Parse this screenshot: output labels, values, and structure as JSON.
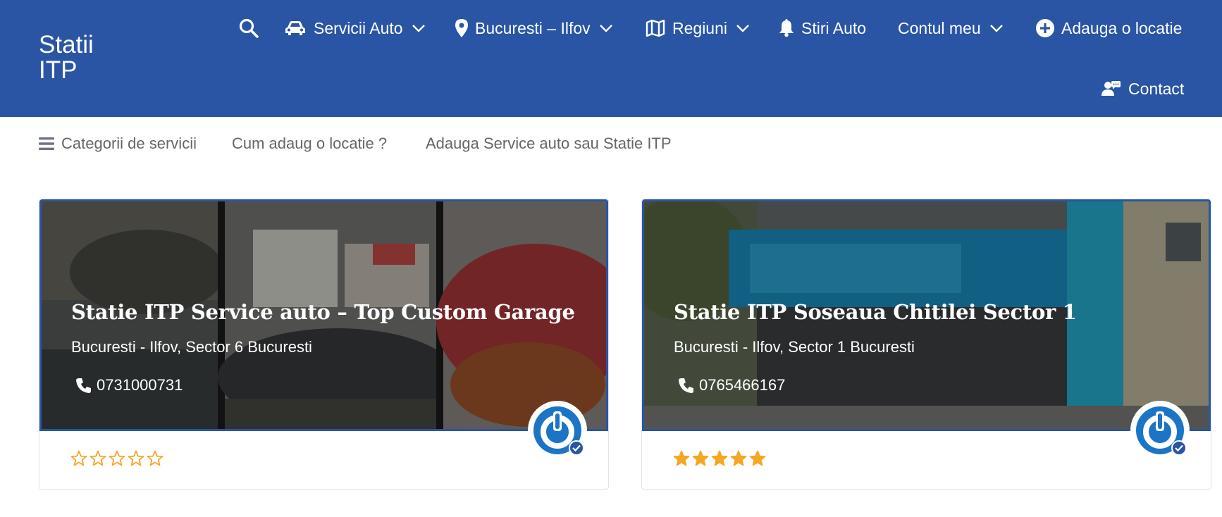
{
  "header": {
    "logo_line1": "Statii",
    "logo_line2": "ITP",
    "nav": {
      "servicii": "Servicii Auto",
      "bucuresti": "Bucuresti – Ilfov",
      "regiuni": "Regiuni",
      "stiri": "Stiri Auto",
      "contul": "Contul meu",
      "adauga": "Adauga o locatie",
      "contact": "Contact"
    },
    "icons": [
      "search-icon",
      "car-icon",
      "map-pin-icon",
      "map-icon",
      "bell-icon",
      "plus-circle-icon",
      "contact-icon",
      "chevron-down-icon"
    ]
  },
  "subnav": {
    "categorii": "Categorii de servicii",
    "cum": "Cum adaug o locatie ?",
    "adauga": "Adauga Service auto sau Statie ITP"
  },
  "listings": [
    {
      "title": "Statie ITP Service auto – Top Custom Garage",
      "location": "Bucuresti - Ilfov, Sector 6 Bucuresti",
      "phone": "0731000731",
      "rating": 0,
      "verified": true
    },
    {
      "title": "Statie ITP Soseaua Chitilei Sector 1",
      "location": "Bucuresti - Ilfov, Sector 1 Bucuresti",
      "phone": "0765466167",
      "rating": 5,
      "verified": true
    }
  ],
  "colors": {
    "brand_blue": "#2a55a5",
    "star_gold": "#f5a623",
    "badge_blue": "#1b74c6"
  }
}
